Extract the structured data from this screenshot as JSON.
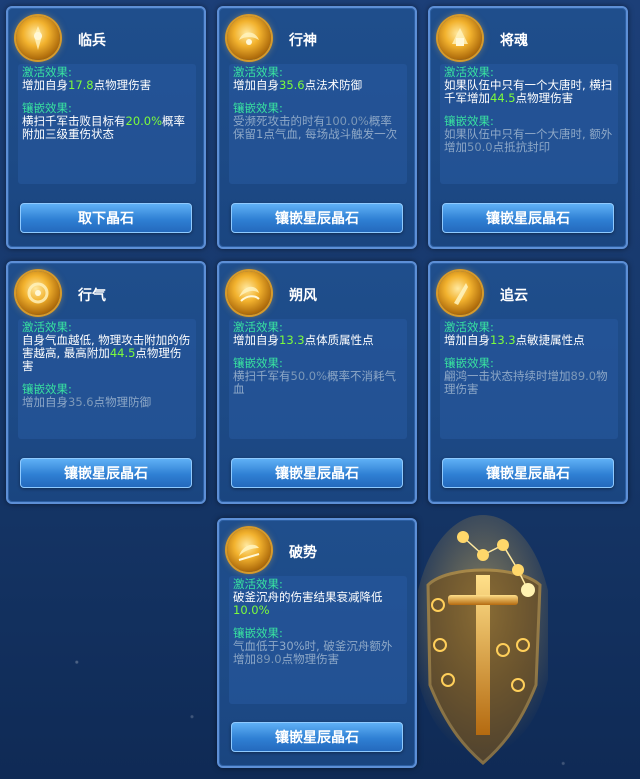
{
  "cards": [
    {
      "name": "临兵",
      "icon": "linbing-orb-icon",
      "activate_title": "激活效果:",
      "activate_text": [
        "增加自身",
        "17.8",
        "点物理伤害"
      ],
      "inlay_title": "镶嵌效果:",
      "inlay_text": [
        "横扫千军击败目标有",
        "20.0%",
        "概率附加三级重伤状态"
      ],
      "inlay_dim": false,
      "button": "取下晶石"
    },
    {
      "name": "行神",
      "icon": "xingshen-orb-icon",
      "activate_title": "激活效果:",
      "activate_text": [
        "增加自身",
        "35.6",
        "点法术防御"
      ],
      "inlay_title": "镶嵌效果:",
      "inlay_text": [
        "受濒死攻击的时有",
        "100.0%",
        "概率保留1点气血, 每场战斗触发一次"
      ],
      "inlay_dim": true,
      "button": "镶嵌星辰晶石"
    },
    {
      "name": "将魂",
      "icon": "jianghun-orb-icon",
      "activate_title": "激活效果:",
      "activate_text": [
        "如果队伍中只有一个大唐时, 横扫千军增加",
        "44.5",
        "点物理伤害"
      ],
      "inlay_title": "镶嵌效果:",
      "inlay_text": [
        "如果队伍中只有一个大唐时, 额外增加",
        "50.0",
        "点抵抗封印"
      ],
      "inlay_dim": true,
      "button": "镶嵌星辰晶石"
    },
    {
      "name": "行气",
      "icon": "xingqi-orb-icon",
      "activate_title": "激活效果:",
      "activate_text": [
        "自身气血越低, 物理攻击附加的伤害越高, 最高附加",
        "44.5",
        "点物理伤害"
      ],
      "inlay_title": "镶嵌效果:",
      "inlay_text": [
        "增加自身",
        "35.6",
        "点物理防御"
      ],
      "inlay_dim": true,
      "button": "镶嵌星辰晶石"
    },
    {
      "name": "朔风",
      "icon": "shuofeng-orb-icon",
      "activate_title": "激活效果:",
      "activate_text": [
        "增加自身",
        "13.3",
        "点体质属性点"
      ],
      "inlay_title": "镶嵌效果:",
      "inlay_text": [
        "横扫千军有",
        "50.0%",
        "概率不消耗气血"
      ],
      "inlay_dim": true,
      "button": "镶嵌星辰晶石"
    },
    {
      "name": "追云",
      "icon": "zhuiyun-orb-icon",
      "activate_title": "激活效果:",
      "activate_text": [
        "增加自身",
        "13.3",
        "点敏捷属性点"
      ],
      "inlay_title": "镶嵌效果:",
      "inlay_text": [
        "翩鸿一击状态持续时增加",
        "89.0",
        "物理伤害"
      ],
      "inlay_dim": true,
      "button": "镶嵌星辰晶石"
    },
    {
      "name": "破势",
      "icon": "poshi-orb-icon",
      "activate_title": "激活效果:",
      "activate_text": [
        "破釜沉舟的伤害结果衰减降低",
        "10.0%",
        ""
      ],
      "inlay_title": "镶嵌效果:",
      "inlay_text": [
        "气血低于30%时, 破釜沉舟额外增加",
        "89.0",
        "点物理伤害"
      ],
      "inlay_dim": true,
      "button": "镶嵌星辰晶石"
    }
  ],
  "decor": {
    "constellation": "star-sword-shield-icon"
  },
  "colors": {
    "heading": "#38e3a0",
    "number": "#7cfc3c",
    "button": "#2f80d4"
  }
}
